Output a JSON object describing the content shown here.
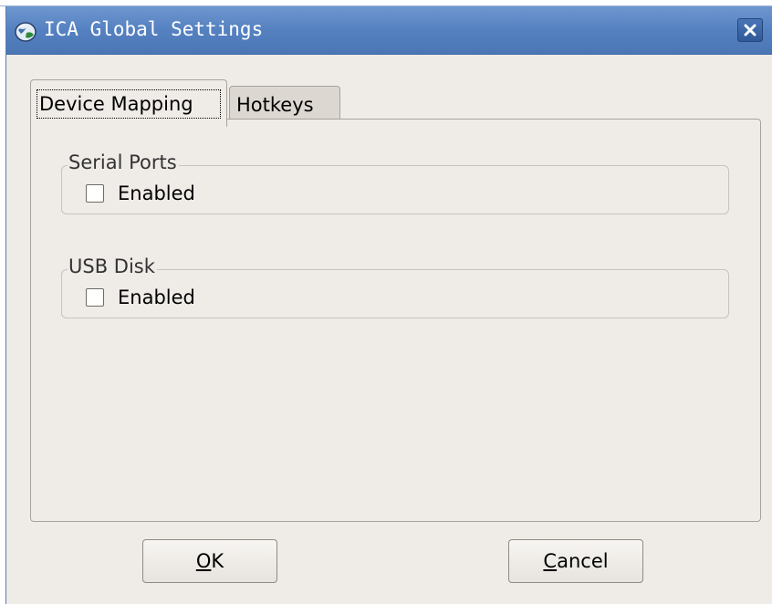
{
  "window": {
    "title": "ICA Global Settings",
    "app_icon": "ica-globe-icon",
    "close_icon": "close-icon"
  },
  "tabs": [
    {
      "label": "Device Mapping",
      "active": true
    },
    {
      "label": "Hotkeys",
      "active": false
    }
  ],
  "groups": {
    "serial_ports": {
      "legend": "Serial Ports",
      "checkbox_label": "Enabled",
      "checked": false
    },
    "usb_disk": {
      "legend": "USB Disk",
      "checkbox_label": "Enabled",
      "checked": false
    }
  },
  "buttons": {
    "ok": {
      "mnemonic": "O",
      "rest": "K"
    },
    "cancel": {
      "mnemonic": "C",
      "rest": "ancel"
    }
  },
  "colors": {
    "titlebar": "#5581c1",
    "window_bg": "#efebe7",
    "title_text": "#ffffff"
  }
}
